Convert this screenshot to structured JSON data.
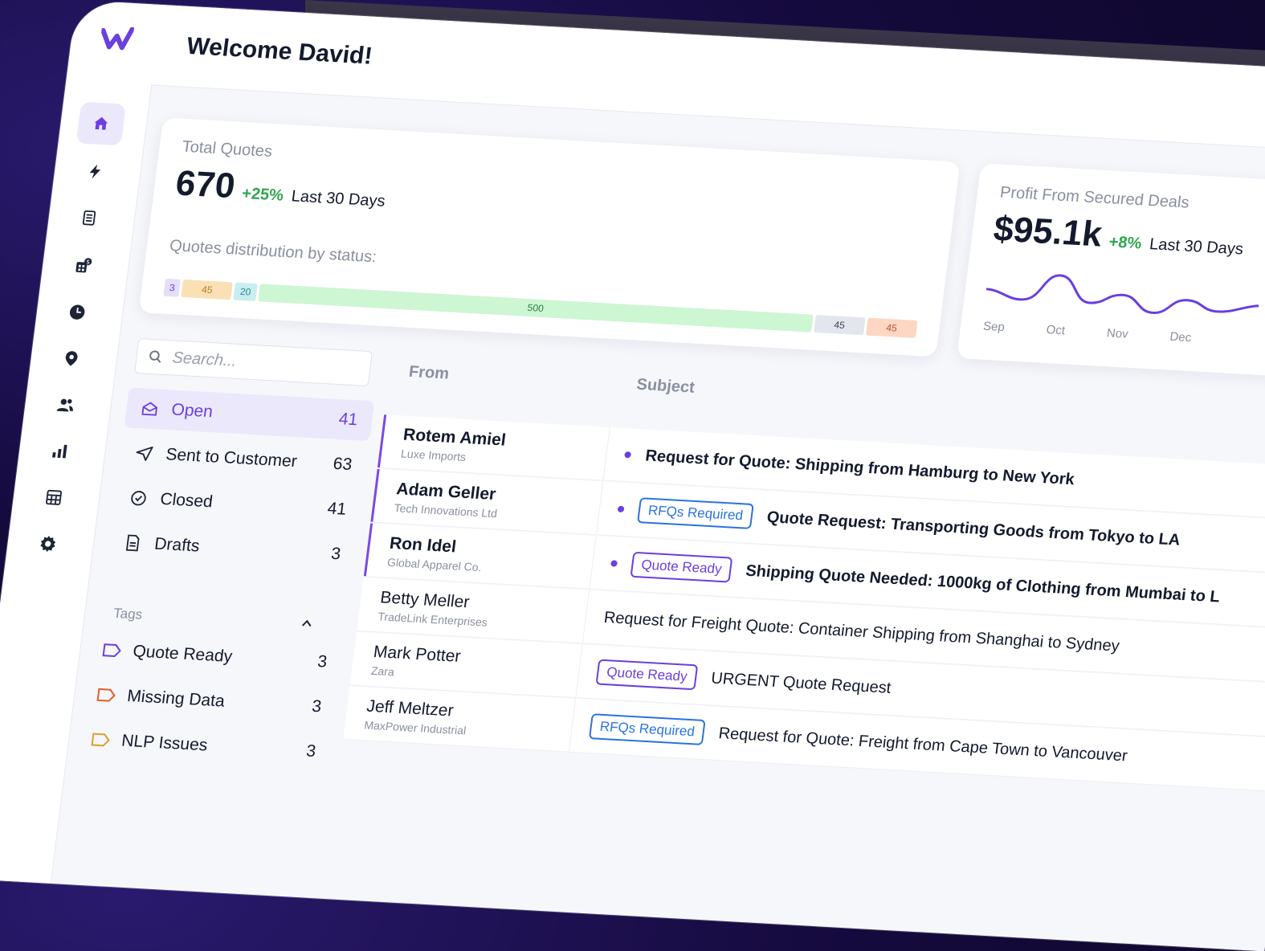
{
  "colors": {
    "accent": "#6b3fe0",
    "rfq": "#2b73e3",
    "positive": "#2fa44f",
    "text": "#141a2e",
    "muted": "#8a90a0"
  },
  "header": {
    "welcome": "Welcome David!"
  },
  "sidebar": {
    "items": [
      {
        "icon": "home-icon",
        "active": true
      },
      {
        "icon": "lightning-icon"
      },
      {
        "icon": "document-list-icon"
      },
      {
        "icon": "calculator-dollar-icon"
      },
      {
        "icon": "clock-icon"
      },
      {
        "icon": "location-pin-icon"
      },
      {
        "icon": "users-icon"
      },
      {
        "icon": "bar-chart-icon"
      },
      {
        "icon": "calculator-icon"
      },
      {
        "icon": "gear-icon"
      }
    ]
  },
  "quotes_card": {
    "label": "Total Quotes",
    "value": "670",
    "change": "+25%",
    "period": "Last 30 Days",
    "dist_label": "Quotes distribution by status:",
    "distribution": [
      {
        "value": "3",
        "color": "#e4def8",
        "text_color": "#6b3fe0"
      },
      {
        "value": "45",
        "color": "#fbe0b6",
        "text_color": "#b77b1f"
      },
      {
        "value": "20",
        "color": "#c9eef0",
        "text_color": "#2b8a94"
      },
      {
        "value": "500",
        "color": "#cdf6d3",
        "text_color": "#2f7c3d"
      },
      {
        "value": "45",
        "color": "#e3e6ec",
        "text_color": "#3b4150"
      },
      {
        "value": "45",
        "color": "#fdd6c4",
        "text_color": "#b4552d"
      }
    ]
  },
  "profit_card": {
    "label": "Profit From Secured Deals",
    "value": "$95.1k",
    "change": "+8%",
    "period": "Last 30 Days",
    "months": [
      "Sep",
      "Oct",
      "Nov",
      "Dec"
    ]
  },
  "search": {
    "placeholder": "Search..."
  },
  "columns": {
    "from": "From",
    "subject": "Subject"
  },
  "folders": [
    {
      "label": "Open",
      "count": "41",
      "icon": "open-envelope-icon",
      "active": true
    },
    {
      "label": "Sent to Customer",
      "count": "63",
      "icon": "send-icon"
    },
    {
      "label": "Closed",
      "count": "41",
      "icon": "check-circle-icon"
    },
    {
      "label": "Drafts",
      "count": "3",
      "icon": "draft-document-icon"
    }
  ],
  "tags_heading": "Tags",
  "tags": [
    {
      "label": "Quote Ready",
      "count": "3",
      "color": "#6b3fe0"
    },
    {
      "label": "Missing Data",
      "count": "3",
      "color": "#e35d2b"
    },
    {
      "label": "NLP Issues",
      "count": "3",
      "color": "#d9a12b"
    }
  ],
  "messages": [
    {
      "name": "Rotem Amiel",
      "company": "Luxe Imports",
      "subject": "Request for Quote: Shipping from Hamburg to New York",
      "badge": "",
      "unread": true
    },
    {
      "name": "Adam Geller",
      "company": "Tech Innovations Ltd",
      "subject": "Quote Request: Transporting Goods from Tokyo to LA",
      "badge": "RFQs Required",
      "unread": true
    },
    {
      "name": "Ron Idel",
      "company": "Global Apparel Co.",
      "subject": "Shipping Quote Needed: 1000kg of Clothing from Mumbai to L",
      "badge": "Quote Ready",
      "unread": true
    },
    {
      "name": "Betty Meller",
      "company": "TradeLink Enterprises",
      "subject": "Request for Freight Quote: Container Shipping from Shanghai to Sydney",
      "badge": "",
      "unread": false
    },
    {
      "name": "Mark Potter",
      "company": "Zara",
      "subject": "URGENT Quote Request",
      "badge": "Quote Ready",
      "unread": false
    },
    {
      "name": "Jeff Meltzer",
      "company": "MaxPower Industrial",
      "subject": "Request for Quote: Freight from Cape Town to Vancouver",
      "badge": "RFQs Required",
      "unread": false
    }
  ]
}
